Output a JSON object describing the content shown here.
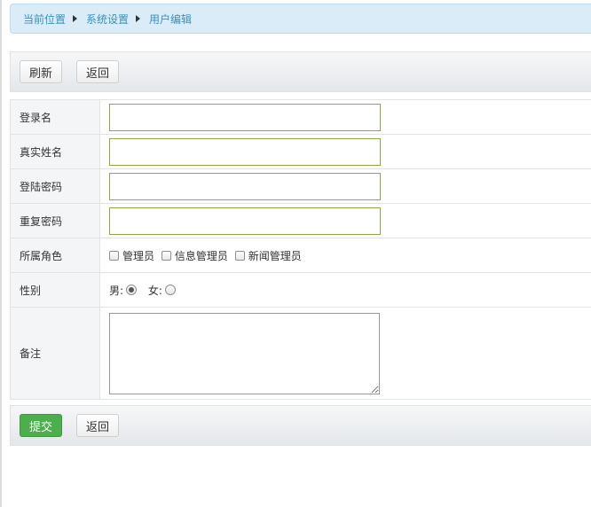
{
  "breadcrumb": {
    "items": [
      "当前位置",
      "系统设置",
      "用户编辑"
    ]
  },
  "top_toolbar": {
    "refresh_label": "刷新",
    "back_label": "返回"
  },
  "form": {
    "username_label": "登录名",
    "username_value": "",
    "realname_label": "真实姓名",
    "realname_value": "",
    "password_label": "登陆密码",
    "password_value": "",
    "repeat_password_label": "重复密码",
    "repeat_password_value": "",
    "role_label": "所属角色",
    "roles": [
      {
        "label": "管理员",
        "checked": false
      },
      {
        "label": "信息管理员",
        "checked": false
      },
      {
        "label": "新闻管理员",
        "checked": false
      }
    ],
    "gender_label": "性别",
    "gender_options": [
      {
        "label": "男:",
        "checked": true
      },
      {
        "label": "女:",
        "checked": false
      }
    ],
    "note_label": "备注",
    "note_value": ""
  },
  "bottom_toolbar": {
    "submit_label": "提交",
    "back_label": "返回"
  },
  "colors": {
    "breadcrumb_bg": "#d9ecf7",
    "breadcrumb_text": "#3a8fbd",
    "input_border": "#8aaa45",
    "submit_bg": "#4cae4c"
  }
}
